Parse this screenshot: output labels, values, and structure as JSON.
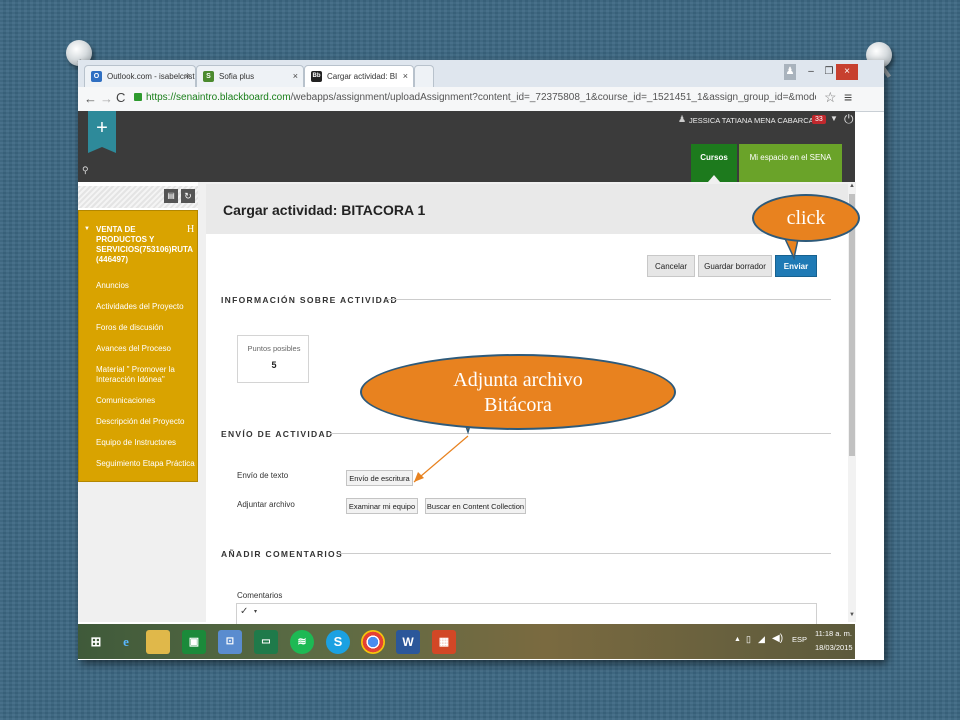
{
  "browser": {
    "tabs": [
      {
        "label": "Outlook.com - isabelcrist",
        "icon": "outlook-icon",
        "icon_text": "O",
        "color": "#2f6fc2"
      },
      {
        "label": "Sofia plus",
        "icon": "sofia-icon",
        "icon_text": "S",
        "color": "#4b8a2e"
      },
      {
        "label": "Cargar actividad: BITACOR",
        "icon": "blackboard-icon",
        "icon_text": "Bb",
        "color": "#222222"
      }
    ],
    "url_host": "https://senaintro.blackboard.com",
    "url_path": "/webapps/assignment/uploadAssignment?content_id=_72375808_1&course_id=_1521451_1&assign_group_id=&mode=view"
  },
  "bb": {
    "user_name": "JESSICA TATIANA MENA CABARCAS",
    "notif_count": "33",
    "tab_courses": "Cursos",
    "tab_myspace": "Mi espacio en el SENA"
  },
  "sidebar": {
    "course_title": "VENTA DE PRODUCTOS Y SERVICIOS(753106)RUTA (446497)",
    "items": [
      "Anuncios",
      "Actividades del Proyecto",
      "Foros de discusión",
      "Avances del Proceso",
      "Material \" Promover la Interacción Idónea\"",
      "Comunicaciones",
      "Descripción del Proyecto",
      "Equipo de Instructores",
      "Seguimiento Etapa Práctica"
    ]
  },
  "page": {
    "title": "Cargar actividad: BITACORA 1",
    "btn_cancel": "Cancelar",
    "btn_draft": "Guardar borrador",
    "btn_submit": "Enviar",
    "section_info": "INFORMACIÓN SOBRE ACTIVIDAD",
    "points_label": "Puntos posibles",
    "points_value": "5",
    "section_submit": "ENVÍO DE ACTIVIDAD",
    "text_label": "Envío de texto",
    "text_button": "Envío de escritura",
    "attach_label": "Adjuntar archivo",
    "browse_button": "Examinar mi equipo",
    "collection_button": "Buscar en Content Collection",
    "section_comments": "AÑADIR COMENTARIOS",
    "comments_label": "Comentarios"
  },
  "callouts": {
    "click": "click",
    "attach_line1": "Adjunta archivo",
    "attach_line2": "Bitácora"
  },
  "taskbar": {
    "lang": "ESP",
    "time": "11:18 a. m.",
    "date": "18/03/2015"
  },
  "colors": {
    "accent_gold": "#d9a300",
    "submit_blue": "#1f7ab5",
    "callout_orange": "#e8821f",
    "courses_green": "#1d7a1d",
    "myspace_green": "#6aa329"
  }
}
